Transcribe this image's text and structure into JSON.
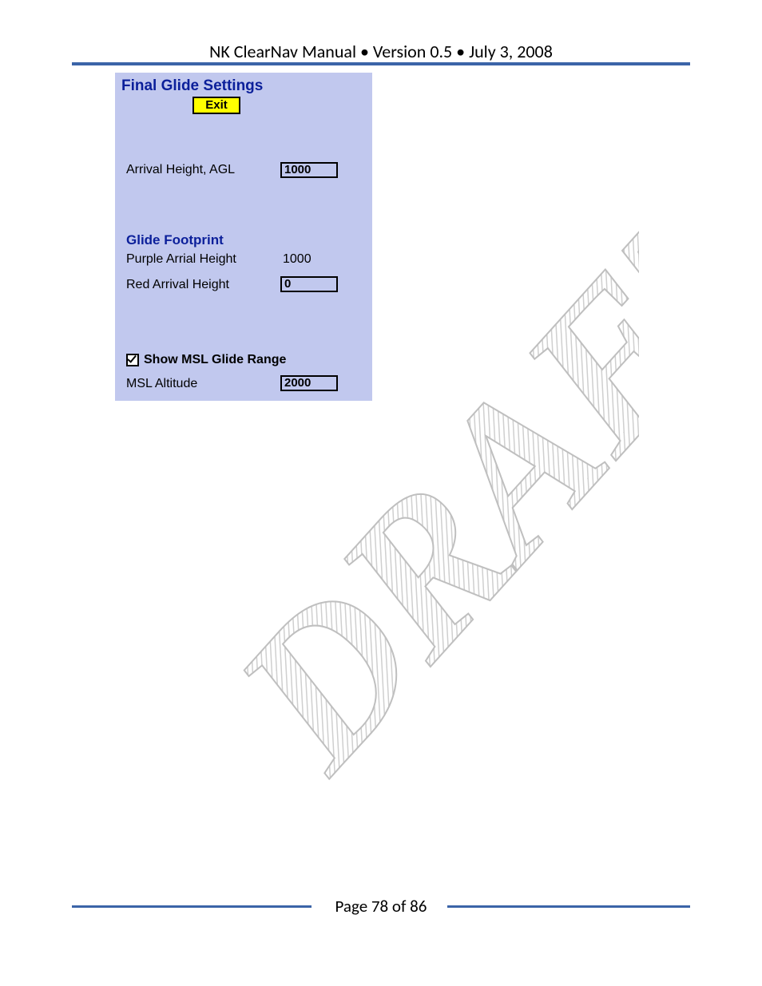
{
  "header": {
    "text": "NK ClearNav Manual • Version 0.5 • July 3, 2008"
  },
  "footer": {
    "text": "Page 78 of 86"
  },
  "watermark": "DRAFT",
  "panel": {
    "title": "Final Glide Settings",
    "exit_label": "Exit",
    "arrival_height_label": "Arrival Height, AGL",
    "arrival_height_value": "1000",
    "glide_footprint": {
      "heading": "Glide Footprint",
      "purple_label": "Purple Arrial Height",
      "purple_value": "1000",
      "red_label": "Red Arrival Height",
      "red_value": "0"
    },
    "msl": {
      "checkbox_label": "Show MSL Glide Range",
      "checkbox_checked": true,
      "altitude_label": "MSL Altitude",
      "altitude_value": "2000"
    }
  }
}
